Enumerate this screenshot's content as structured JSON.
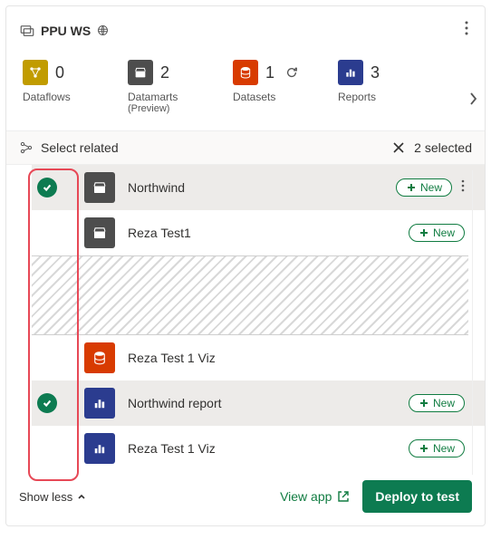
{
  "workspace": {
    "name": "PPU WS"
  },
  "summary": [
    {
      "icon": "dataflow",
      "count": "0",
      "label": "Dataflows",
      "sub": "",
      "refresh": false,
      "color": "c-dataflow"
    },
    {
      "icon": "datamart",
      "count": "2",
      "label": "Datamarts",
      "sub": "(Preview)",
      "refresh": false,
      "color": "c-datamart"
    },
    {
      "icon": "dataset",
      "count": "1",
      "label": "Datasets",
      "sub": "",
      "refresh": true,
      "color": "c-dataset"
    },
    {
      "icon": "report",
      "count": "3",
      "label": "Reports",
      "sub": "",
      "refresh": false,
      "color": "c-report"
    }
  ],
  "toolbar": {
    "select_related": "Select related",
    "selected_count": "2 selected"
  },
  "items": [
    {
      "selected": true,
      "icon": "datamart",
      "color": "c-datamart",
      "name": "Northwind",
      "new": true,
      "more": true
    },
    {
      "selected": false,
      "icon": "datamart",
      "color": "c-datamart",
      "name": "Reza Test1",
      "new": true,
      "more": false
    },
    {
      "selected": false,
      "icon": "dataset",
      "color": "c-dataset",
      "name": "Reza Test 1 Viz",
      "new": false,
      "more": false
    },
    {
      "selected": true,
      "icon": "report",
      "color": "c-report",
      "name": "Northwind report",
      "new": true,
      "more": false
    },
    {
      "selected": false,
      "icon": "report",
      "color": "c-report",
      "name": "Reza Test 1 Viz",
      "new": true,
      "more": false
    }
  ],
  "labels": {
    "new": "New",
    "show_less": "Show less",
    "view_app": "View app",
    "deploy": "Deploy to test"
  }
}
